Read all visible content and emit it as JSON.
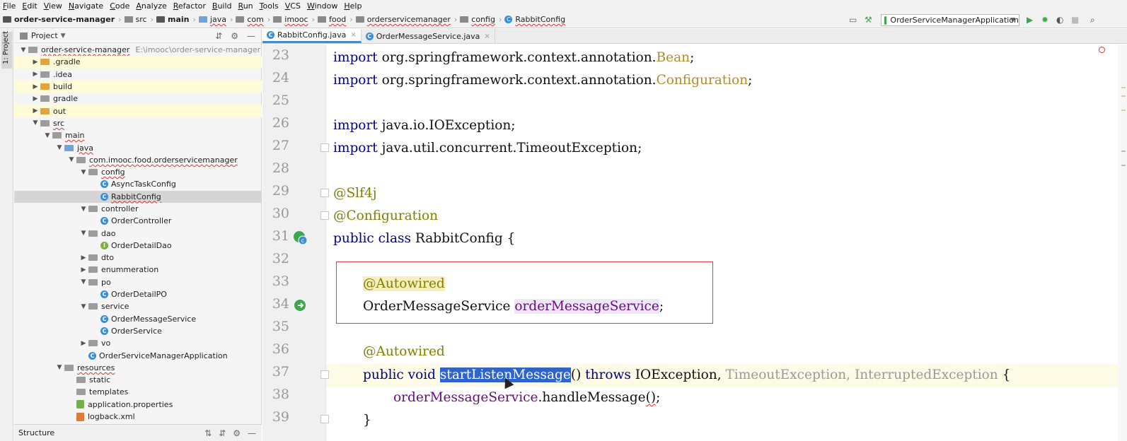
{
  "menu": [
    "File",
    "Edit",
    "View",
    "Navigate",
    "Code",
    "Analyze",
    "Refactor",
    "Build",
    "Run",
    "Tools",
    "VCS",
    "Window",
    "Help"
  ],
  "breadcrumb": [
    "order-service-manager",
    "src",
    "main",
    "java",
    "com",
    "imooc",
    "food",
    "orderservicemanager",
    "config",
    "RabbitConfig"
  ],
  "run_config": "OrderServiceManagerApplication",
  "tool_window": {
    "vertical_tab": "1: Project",
    "header": "Project",
    "structure": "Structure"
  },
  "tree": [
    {
      "label": "order-service-manager",
      "path": "E:\\imooc\\order-service-manager",
      "depth": 0,
      "arrow": "down",
      "icon": "folder"
    },
    {
      "label": ".gradle",
      "depth": 1,
      "arrow": "right",
      "icon": "folder-orange",
      "hl": true
    },
    {
      "label": ".idea",
      "depth": 1,
      "arrow": "right",
      "icon": "folder"
    },
    {
      "label": "build",
      "depth": 1,
      "arrow": "right",
      "icon": "folder-orange",
      "hl": true
    },
    {
      "label": "gradle",
      "depth": 1,
      "arrow": "right",
      "icon": "folder"
    },
    {
      "label": "out",
      "depth": 1,
      "arrow": "right",
      "icon": "folder-orange",
      "hl": true
    },
    {
      "label": "src",
      "depth": 1,
      "arrow": "down",
      "icon": "folder"
    },
    {
      "label": "main",
      "depth": 2,
      "arrow": "down",
      "icon": "folder"
    },
    {
      "label": "java",
      "depth": 3,
      "arrow": "down",
      "icon": "folder-blue"
    },
    {
      "label": "com.imooc.food.orderservicemanager",
      "depth": 4,
      "arrow": "down",
      "icon": "package"
    },
    {
      "label": "config",
      "depth": 5,
      "arrow": "down",
      "icon": "package"
    },
    {
      "label": "AsyncTaskConfig",
      "depth": 6,
      "icon": "class"
    },
    {
      "label": "RabbitConfig",
      "depth": 6,
      "icon": "class",
      "sel": true
    },
    {
      "label": "controller",
      "depth": 5,
      "arrow": "down",
      "icon": "package"
    },
    {
      "label": "OrderController",
      "depth": 6,
      "icon": "class"
    },
    {
      "label": "dao",
      "depth": 5,
      "arrow": "down",
      "icon": "package"
    },
    {
      "label": "OrderDetailDao",
      "depth": 6,
      "icon": "interface"
    },
    {
      "label": "dto",
      "depth": 5,
      "arrow": "right",
      "icon": "package"
    },
    {
      "label": "enummeration",
      "depth": 5,
      "arrow": "right",
      "icon": "package"
    },
    {
      "label": "po",
      "depth": 5,
      "arrow": "down",
      "icon": "package"
    },
    {
      "label": "OrderDetailPO",
      "depth": 6,
      "icon": "class"
    },
    {
      "label": "service",
      "depth": 5,
      "arrow": "down",
      "icon": "package"
    },
    {
      "label": "OrderMessageService",
      "depth": 6,
      "icon": "class"
    },
    {
      "label": "OrderService",
      "depth": 6,
      "icon": "class"
    },
    {
      "label": "vo",
      "depth": 5,
      "arrow": "right",
      "icon": "package"
    },
    {
      "label": "OrderServiceManagerApplication",
      "depth": 5,
      "icon": "class"
    },
    {
      "label": "resources",
      "depth": 3,
      "arrow": "down",
      "icon": "folder"
    },
    {
      "label": "static",
      "depth": 4,
      "icon": "folder"
    },
    {
      "label": "templates",
      "depth": 4,
      "icon": "folder"
    },
    {
      "label": "application.properties",
      "depth": 4,
      "icon": "file"
    },
    {
      "label": "logback.xml",
      "depth": 4,
      "icon": "xml"
    }
  ],
  "tabs": [
    {
      "label": "RabbitConfig.java",
      "active": true
    },
    {
      "label": "OrderMessageService.java",
      "active": false
    }
  ],
  "editor": {
    "line_numbers": [
      "23",
      "24",
      "25",
      "26",
      "27",
      "28",
      "29",
      "30",
      "31",
      "32",
      "33",
      "34",
      "35",
      "36",
      "37",
      "38",
      "39"
    ],
    "code": {
      "l23_kw": "import",
      "l23_pkg": " org.springframework.context.annotation.",
      "l23_cls": "Bean",
      "l23_end": ";",
      "l24_kw": "import",
      "l24_pkg": " org.springframework.context.annotation.",
      "l24_cls": "Configuration",
      "l24_end": ";",
      "l26_kw": "import",
      "l26_rest": " java.io.IOException;",
      "l27_kw": "import",
      "l27_rest": " java.util.concurrent.TimeoutException;",
      "l29": "@Slf4j",
      "l30": "@Configuration",
      "l31_kw": "public class",
      "l31_rest": " RabbitConfig {",
      "l33": "@Autowired",
      "l34_type": "OrderMessageService ",
      "l34_field": "orderMessageService",
      "l34_end": ";",
      "l36": "@Autowired",
      "l37_kw": "public void",
      "l37_sp": " ",
      "l37_method": "startListenMessage",
      "l37_paren": "()",
      "l37_throws": " throws",
      "l37_ex1": " IOException,",
      "l37_ex2": " TimeoutException,",
      "l37_ex3": " InterruptedException",
      "l37_end": " {",
      "l38_field": "orderMessageService",
      "l38_dot": ".handleMessage",
      "l38_call": "()",
      "l38_end": ";",
      "l39": "}"
    }
  }
}
